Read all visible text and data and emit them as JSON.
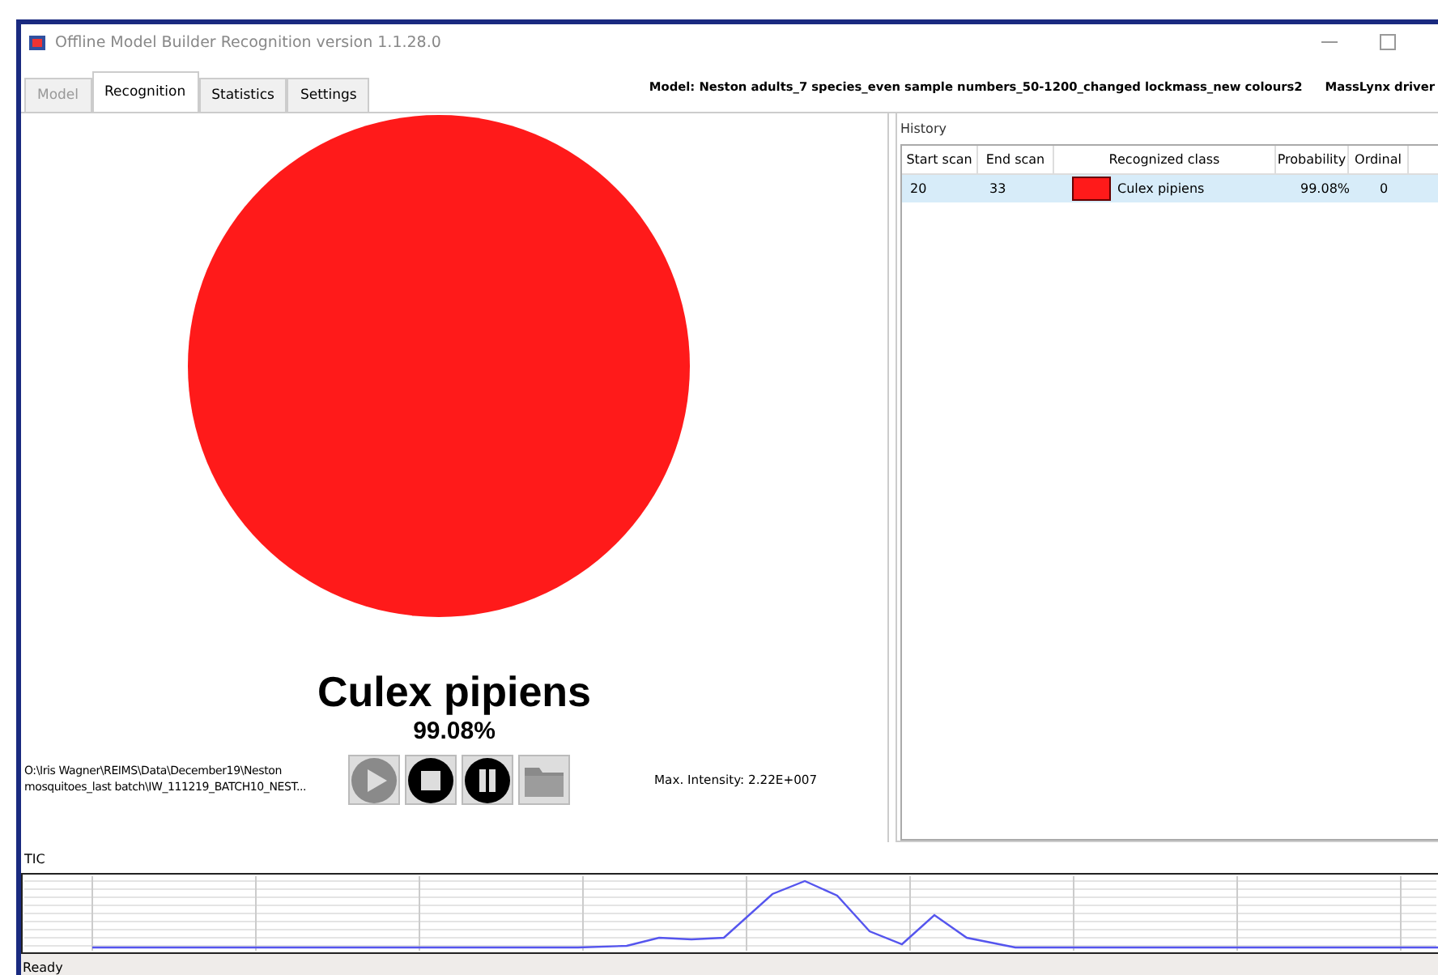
{
  "window": {
    "title": "Offline Model Builder Recognition version 1.1.28.0"
  },
  "tabs": [
    {
      "label": "Model",
      "selected": false,
      "disabled": true
    },
    {
      "label": "Recognition",
      "selected": true,
      "disabled": false
    },
    {
      "label": "Statistics",
      "selected": false,
      "disabled": false
    },
    {
      "label": "Settings",
      "selected": false,
      "disabled": false
    }
  ],
  "model_label": "Model: Neston adults_7 species_even sample numbers_50-1200_changed lockmass_new colours2",
  "driver_label": "MassLynx driver",
  "result": {
    "class": "Culex pipiens",
    "probability": "99.08%",
    "color": "#ff1a1a"
  },
  "file_path": "O:\\Iris Wagner\\REIMS\\Data\\December19\\Neston mosquitoes_last batch\\IW_111219_BATCH10_NEST...",
  "controls": [
    {
      "kind": "play",
      "disabled": true
    },
    {
      "kind": "stop",
      "disabled": false
    },
    {
      "kind": "pause",
      "disabled": false
    },
    {
      "kind": "open",
      "disabled": true
    }
  ],
  "max_intensity": "Max. Intensity: 2.22E+007",
  "history": {
    "title": "History",
    "columns": [
      "Start scan",
      "End scan",
      "Recognized class",
      "Probability",
      "Ordinal"
    ],
    "rows": [
      {
        "start": "20",
        "end": "33",
        "class": "Culex pipiens",
        "color": "#ff1a1a",
        "probability": "99.08%",
        "ordinal": "0",
        "selected": true
      }
    ]
  },
  "tic": {
    "title": "TIC"
  },
  "status_bar": "Ready"
}
